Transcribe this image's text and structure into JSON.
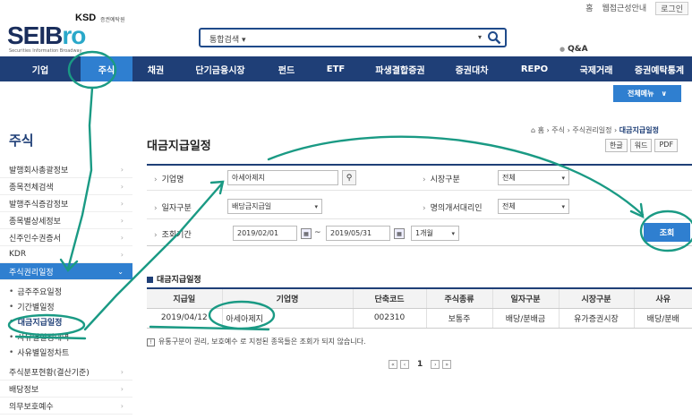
{
  "util": {
    "home": "홈",
    "web_guide": "웹접근성안내",
    "login": "로그인"
  },
  "logo": {
    "ksd": "KSD",
    "ksd_sub": "증권예탁원",
    "mark_a": "SEIB",
    "mark_b": "ro",
    "tagline": "Securities Information Broadway"
  },
  "search": {
    "scope": "통합검색",
    "icon": "search-icon"
  },
  "qa": "Q&A",
  "nav": {
    "items": [
      "기업",
      "주식",
      "채권",
      "단기금융시장",
      "펀드",
      "ETF",
      "파생결합증권",
      "증권대차",
      "REPO",
      "국제거래",
      "증권예탁통계"
    ],
    "active_index": 1
  },
  "all_menu": "전체메뉴",
  "sidebar": {
    "title": "주식",
    "items": [
      "발행회사총괄정보",
      "종목전체검색",
      "발행주식증감정보",
      "종목별상세정보",
      "신주인수권증서",
      "KDR",
      "주식권리일정"
    ],
    "active_label": "주식권리일정",
    "sub_items": [
      "금주주요일정",
      "기간별일정",
      "대금지급일정",
      "사유별일정내역",
      "사유별일정차트"
    ],
    "sub_active_index": 2,
    "after_items": [
      "주식분포현황(결산기준)",
      "배당정보",
      "의무보호예수"
    ]
  },
  "page": {
    "title": "대금지급일정",
    "breadcrumb": [
      "홈",
      "주식",
      "주식권리일정",
      "대금지급일정"
    ],
    "tools": [
      "한글",
      "워드",
      "PDF"
    ]
  },
  "filter": {
    "company_label": "기업명",
    "company_value": "아세아제지",
    "market_label": "시장구분",
    "market_value": "전체",
    "date_type_label": "일자구분",
    "date_type_value": "배당금지급일",
    "agent_label": "명의개서대리인",
    "agent_value": "전체",
    "period_label": "조회기간",
    "date_from": "2019/02/01",
    "date_to": "2019/05/31",
    "period_range": "1개월",
    "query_button": "조회"
  },
  "results": {
    "section_title": "대금지급일정",
    "columns": [
      "지급일",
      "기업명",
      "단축코드",
      "주식종류",
      "일자구분",
      "시장구분",
      "사유"
    ],
    "rows": [
      [
        "2019/04/12",
        "아세아제지",
        "002310",
        "보통주",
        "배당/분배금",
        "유가증권시장",
        "배당/분배"
      ]
    ],
    "note": "유통구분이 권리, 보호예수 로 지정된 종목들은 조회가 되지 않습니다."
  },
  "pager": {
    "current": "1"
  },
  "annotation_color": "#1a9a84"
}
